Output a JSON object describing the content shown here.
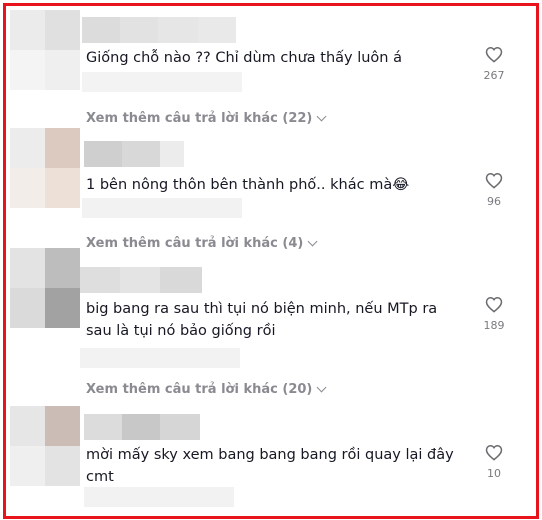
{
  "comments": [
    {
      "text": "Giống chỗ nào ?? Chỉ dùm chưa thấy luôn á",
      "likes": "267"
    },
    {
      "text": "1 bên nông thôn bên thành phố.. khác mà😂",
      "likes": "96"
    },
    {
      "text": "big bang ra sau thì tụi nó biện minh, nếu MTp ra sau là tụi nó bảo giống rồi",
      "likes": "189"
    },
    {
      "text": "mời mấy sky xem bang bang bang rồi quay lại đây cmt",
      "likes": "10"
    }
  ],
  "replies": [
    {
      "label": "Xem thêm câu trả lời khác (22)"
    },
    {
      "label": "Xem thêm câu trả lời khác (4)"
    },
    {
      "label": "Xem thêm câu trả lời khác (20)"
    }
  ],
  "icons": {
    "like": "heart-outline-icon",
    "expand": "chevron-down-icon"
  },
  "colors": {
    "frame_border": "#e8141b",
    "text": "#161823",
    "muted": "#8a8b91"
  }
}
